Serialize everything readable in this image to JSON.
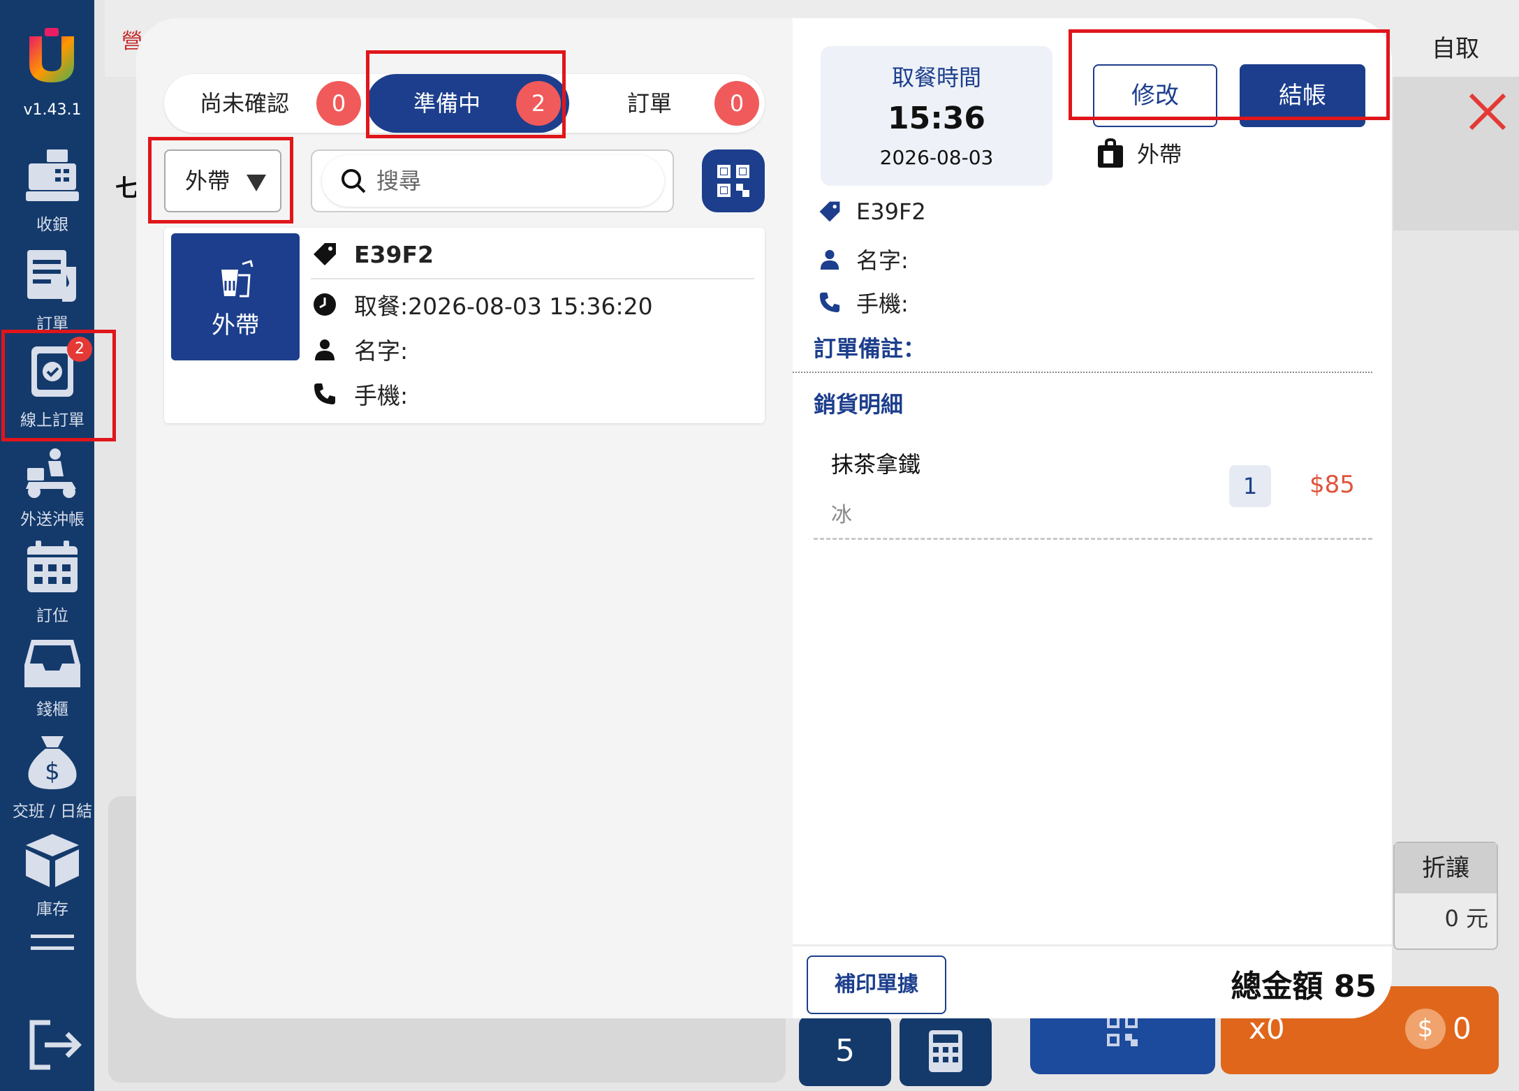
{
  "app": {
    "version": "v1.43.1",
    "logo_icon": "u-logo-icon"
  },
  "sidebar": {
    "items": [
      {
        "label": "收銀",
        "icon": "cash-register-icon"
      },
      {
        "label": "訂單",
        "icon": "order-list-icon"
      },
      {
        "label": "線上訂單",
        "icon": "online-order-icon",
        "badge": "2"
      },
      {
        "label": "外送沖帳",
        "icon": "scooter-delivery-icon"
      },
      {
        "label": "訂位",
        "icon": "calendar-icon"
      },
      {
        "label": "錢櫃",
        "icon": "cash-drawer-icon"
      },
      {
        "label": "交班 / 日結",
        "icon": "money-bag-icon"
      },
      {
        "label": "庫存",
        "icon": "inventory-box-icon"
      }
    ],
    "logout_icon": "logout-icon"
  },
  "background": {
    "header_fragment": "營",
    "side_fragment": "七",
    "pickup_title": "自取",
    "discount_label": "折讓",
    "discount_value": "0 元",
    "keypad_5": "5",
    "count_label": "x0",
    "amount_label": "0"
  },
  "modal": {
    "tabs": [
      {
        "label": "尚未確認",
        "count": "0"
      },
      {
        "label": "準備中",
        "count": "2"
      },
      {
        "label": "訂單",
        "count": "0"
      }
    ],
    "type_filter": "外帶",
    "search_placeholder": "搜尋",
    "order": {
      "type_label": "外帶",
      "code": "E39F2",
      "pickup": "取餐:2026-08-03 15:36:20",
      "name": "名字:",
      "phone": "手機:"
    },
    "detail": {
      "pickup_time_label": "取餐時間",
      "pickup_time": "15:36",
      "pickup_date": "2026-08-03",
      "edit_label": "修改",
      "checkout_label": "結帳",
      "takeout_label": "外帶",
      "code": "E39F2",
      "name": "名字:",
      "phone": "手機:",
      "note_label": "訂單備註：",
      "sales_label": "銷貨明細",
      "items": [
        {
          "name": "抹茶拿鐵",
          "option": "冰",
          "qty": "1",
          "price": "$85"
        }
      ],
      "reprint_label": "補印單據",
      "total_label": "總金額 85"
    }
  },
  "colors": {
    "primary": "#1c3e8c",
    "sidebar": "#143a6c",
    "badge": "#f05a5a",
    "price": "#e0533a",
    "highlight": "#e0161b"
  }
}
